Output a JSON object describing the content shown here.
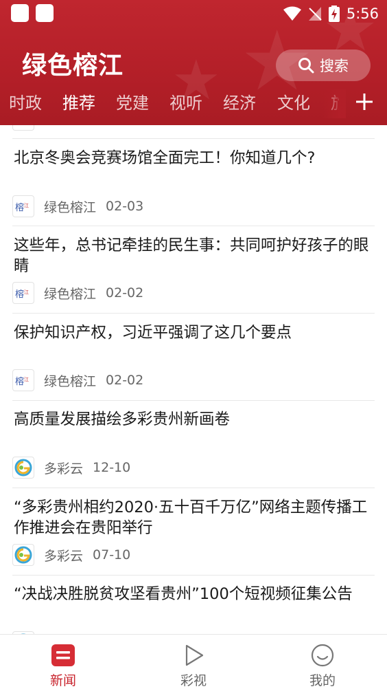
{
  "status_bar": {
    "time": "5:56"
  },
  "header": {
    "app_title": "绿色榕江",
    "search_label": "搜索"
  },
  "tabs": [
    {
      "label": "时政",
      "active": false
    },
    {
      "label": "推荐",
      "active": true
    },
    {
      "label": "党建",
      "active": false
    },
    {
      "label": "视听",
      "active": false
    },
    {
      "label": "经济",
      "active": false
    },
    {
      "label": "文化",
      "active": false
    },
    {
      "label": "旅",
      "active": false
    }
  ],
  "feed": {
    "items": [
      {
        "title": "北京冬奥会竞赛场馆全面完工！你知道几个?",
        "source": "绿色榕江",
        "date": "02-03",
        "logo": "lvse-rongjiang-logo"
      },
      {
        "title": "这些年，总书记牵挂的民生事：共同呵护好孩子的眼睛",
        "source": "绿色榕江",
        "date": "02-02",
        "logo": "lvse-rongjiang-logo"
      },
      {
        "title": "保护知识产权，习近平强调了这几个要点",
        "source": "绿色榕江",
        "date": "02-02",
        "logo": "lvse-rongjiang-logo"
      },
      {
        "title": "高质量发展描绘多彩贵州新画卷",
        "source": "多彩云",
        "date": "12-10",
        "logo": "duocaiyun-logo"
      },
      {
        "title": "“多彩贵州相约2020·五十百千万亿”网络主题传播工作推进会在贵阳举行",
        "source": "多彩云",
        "date": "07-10",
        "logo": "duocaiyun-logo"
      },
      {
        "title": "“决战决胜脱贫攻坚看贵州”100个短视频征集公告",
        "source": "",
        "date": "",
        "logo": "duocaiyun-logo"
      }
    ]
  },
  "bottom_nav": [
    {
      "label": "新闻",
      "icon": "news-icon",
      "active": true
    },
    {
      "label": "彩视",
      "icon": "play-icon",
      "active": false
    },
    {
      "label": "我的",
      "icon": "smile-icon",
      "active": false
    }
  ],
  "colors": {
    "brand_red": "#b31f28",
    "active_nav": "#c8232c"
  }
}
